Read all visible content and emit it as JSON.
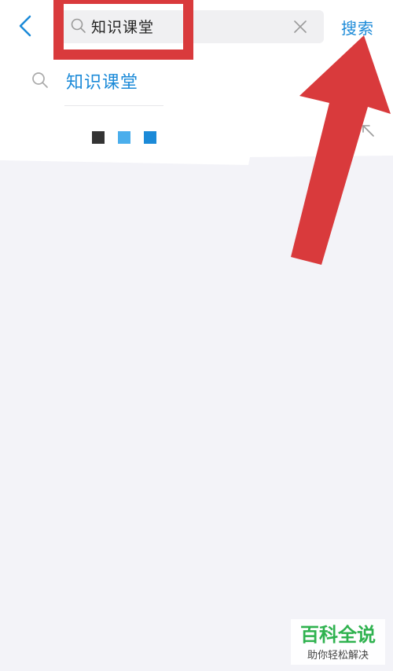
{
  "header": {
    "query": "知识课堂",
    "search_button": "搜索"
  },
  "suggestion": {
    "text": "知识课堂"
  },
  "loading": {
    "dot_colors": [
      "#333333",
      "#4aaeec",
      "#1b8ad8"
    ]
  },
  "colors": {
    "accent": "#1b8ad8",
    "annotation": "#d93a3c",
    "logo_green": "#2fb24f"
  },
  "watermark": {
    "brand": "百科全说",
    "tagline": "助你轻松解决"
  }
}
